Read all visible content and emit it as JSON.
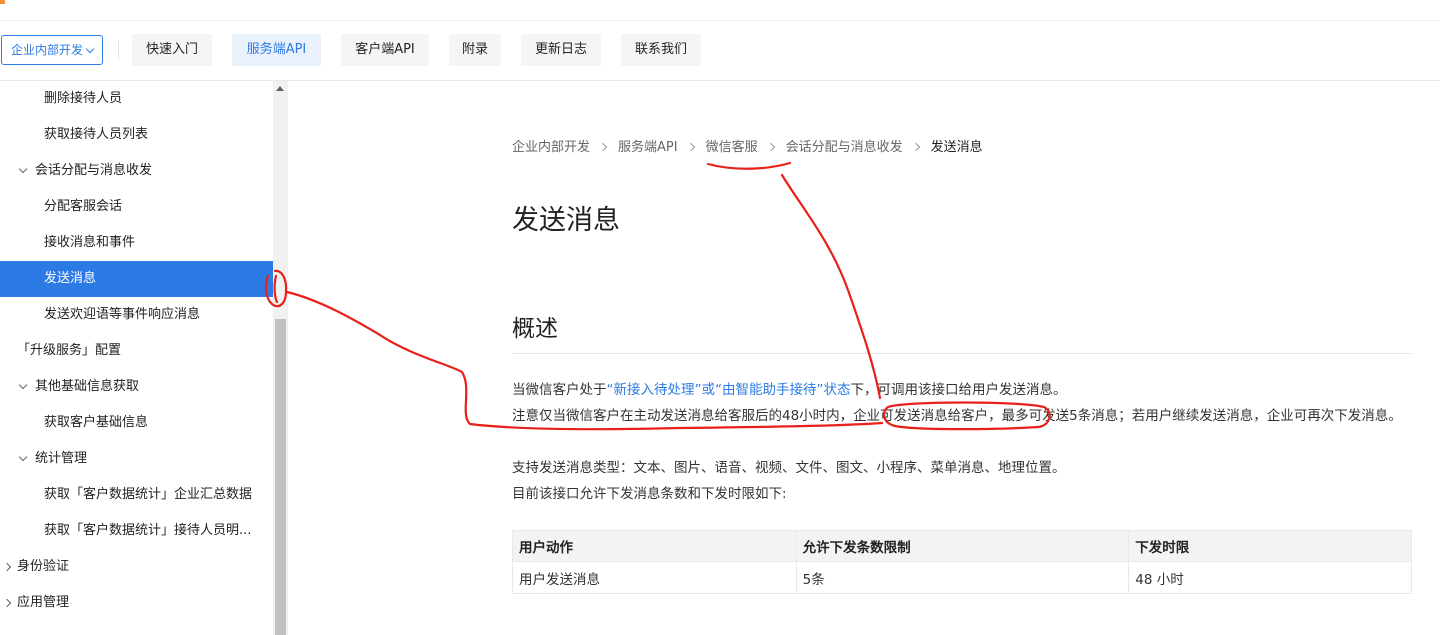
{
  "header": {
    "dropdown_label": "企业内部开发",
    "nav": [
      "快速入门",
      "服务端API",
      "客户端API",
      "附录",
      "更新日志",
      "联系我们"
    ],
    "active_nav": "服务端API"
  },
  "sidebar": {
    "items": [
      {
        "label": "删除接待人员",
        "level": 2,
        "caret": "none",
        "active": false
      },
      {
        "label": "获取接待人员列表",
        "level": 2,
        "caret": "none",
        "active": false
      },
      {
        "label": "会话分配与消息收发",
        "level": 1,
        "caret": "down",
        "active": false
      },
      {
        "label": "分配客服会话",
        "level": 2,
        "caret": "none",
        "active": false
      },
      {
        "label": "接收消息和事件",
        "level": 2,
        "caret": "none",
        "active": false
      },
      {
        "label": "发送消息",
        "level": 2,
        "caret": "none",
        "active": true
      },
      {
        "label": "发送欢迎语等事件响应消息",
        "level": 2,
        "caret": "none",
        "active": false
      },
      {
        "label": "「升级服务」配置",
        "level": 1,
        "caret": "none",
        "active": false
      },
      {
        "label": "其他基础信息获取",
        "level": 1,
        "caret": "down",
        "active": false
      },
      {
        "label": "获取客户基础信息",
        "level": 2,
        "caret": "none",
        "active": false
      },
      {
        "label": "统计管理",
        "level": 1,
        "caret": "down",
        "active": false
      },
      {
        "label": "获取「客户数据统计」企业汇总数据",
        "level": 2,
        "caret": "none",
        "active": false
      },
      {
        "label": "获取「客户数据统计」接待人员明...",
        "level": 2,
        "caret": "none",
        "active": false
      },
      {
        "label": "身份验证",
        "level": 0,
        "caret": "right",
        "active": false
      },
      {
        "label": "应用管理",
        "level": 0,
        "caret": "right",
        "active": false
      }
    ]
  },
  "breadcrumb": [
    "企业内部开发",
    "服务端API",
    "微信客服",
    "会话分配与消息收发",
    "发送消息"
  ],
  "page_title": "发送消息",
  "section_title": "概述",
  "paragraphs": {
    "p1_pre": "当微信客户处于",
    "p1_link": "“新接入待处理”或“由智能助手接待”状态",
    "p1_post": "下，可调用该接口给用户发送消息。",
    "p2": "注意仅当微信客户在主动发送消息给客服后的48小时内，企业可发送消息给客户，最多可发送5条消息；若用户继续发送消息，企业可再次下发消息。",
    "p3": "支持发送消息类型：文本、图片、语音、视频、文件、图文、小程序、菜单消息、地理位置。",
    "p4": "目前该接口允许下发消息条数和下发时限如下:"
  },
  "table": {
    "headers": [
      "用户动作",
      "允许下发条数限制",
      "下发时限"
    ],
    "rows": [
      [
        "用户发送消息",
        "5条",
        "48 小时"
      ]
    ]
  },
  "colors": {
    "accent": "#2c7be5",
    "annotation": "#e8201a"
  }
}
